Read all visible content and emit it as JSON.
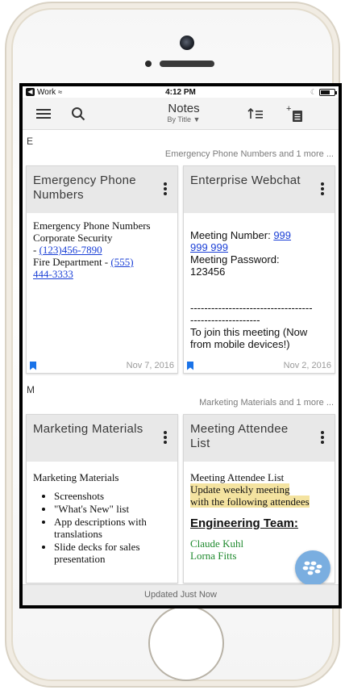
{
  "statusbar": {
    "carrier": "Work",
    "time": "4:12 PM"
  },
  "toolbar": {
    "title": "Notes",
    "subtitle": "By Title ▼"
  },
  "sections": [
    {
      "letter": "E",
      "summary": "Emergency Phone Numbers and 1 more ...",
      "cards": [
        {
          "title": "Emergency Phone Numbers",
          "date": "Nov 7, 2016",
          "lines": [
            "Emergency Phone Numbers",
            "Corporate Security",
            "- ",
            "(123)456-7890",
            "Fire Department - ",
            "(555)",
            "444-3333"
          ]
        },
        {
          "title": "Enterprise Webchat",
          "date": "Nov 2, 2016",
          "lines": [
            "Meeting Number: ",
            "999",
            "999 999",
            "Meeting Password:",
            "123456",
            "-----------------------------------",
            "--------------------",
            "To join this meeting (Now",
            "from mobile devices!)"
          ]
        }
      ]
    },
    {
      "letter": "M",
      "summary": "Marketing Materials and 1 more ...",
      "cards": [
        {
          "title": "Marketing Materials",
          "lines": [
            "Marketing Materials"
          ],
          "bullets": [
            "Screenshots",
            "\"What's New\" list",
            "App descriptions with translations",
            "Slide decks for sales presentation"
          ]
        },
        {
          "title": "Meeting Attendee List",
          "lines": [
            "Meeting Attendee List",
            "Update weekly meeting",
            "with the following attendees",
            "Engineering Team:",
            "Claude Kuhl",
            "Lorna Fitts"
          ]
        }
      ]
    }
  ],
  "footer": {
    "status": "Updated Just Now"
  },
  "colors": {
    "link": "#1a3fd6",
    "highlight": "#f4e3a0",
    "fab": "#7aaee0",
    "bookmark": "#1a73e8",
    "green_text": "#1f8a2e"
  },
  "icons": [
    "menu-icon",
    "search-icon",
    "sort-icon",
    "add-note-icon",
    "more-options-icon",
    "bookmark-icon",
    "blackberry-icon"
  ]
}
